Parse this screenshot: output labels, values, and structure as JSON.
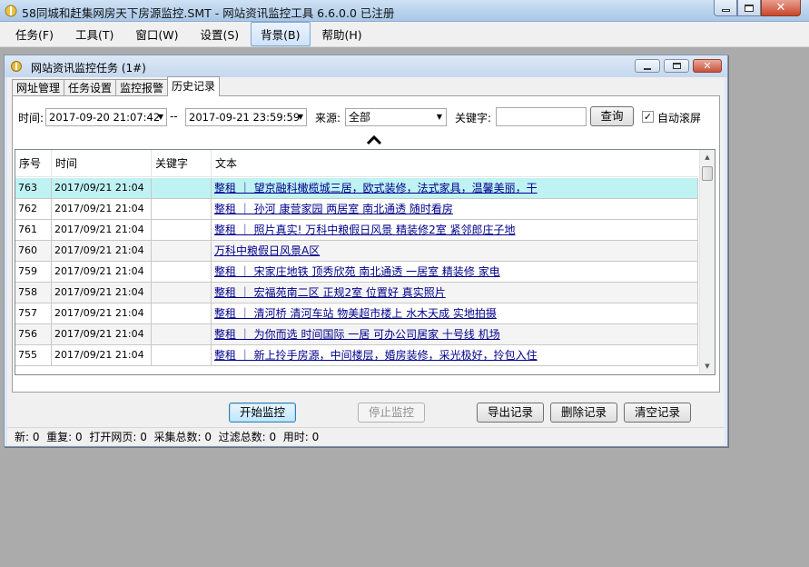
{
  "app": {
    "title": "58同城和赶集网房天下房源监控.SMT  - 网站资讯监控工具 6.6.0.0  已注册"
  },
  "menu": [
    {
      "label": "任务(F)"
    },
    {
      "label": "工具(T)"
    },
    {
      "label": "窗口(W)"
    },
    {
      "label": "设置(S)"
    },
    {
      "label": "背景(B)",
      "active": true
    },
    {
      "label": "帮助(H)"
    }
  ],
  "child_window": {
    "title": "网站资讯监控任务  (1#)"
  },
  "tabs": [
    {
      "label": "网址管理"
    },
    {
      "label": "任务设置"
    },
    {
      "label": "监控报警"
    },
    {
      "label": "历史记录",
      "active": true
    }
  ],
  "filter": {
    "time_label": "时间:",
    "start_time": "2017-09-20  21:07:42",
    "separator": "--",
    "end_time": "2017-09-21  23:59:59",
    "source_label": "来源:",
    "source_value": "全部",
    "keyword_label": "关键字:",
    "keyword_value": "",
    "query_button": "查询",
    "auto_scroll_label": "自动滚屏",
    "auto_scroll_checked": true
  },
  "table": {
    "columns": [
      "序号",
      "时间",
      "关键字",
      "文本"
    ],
    "rows": [
      {
        "id": "763",
        "time": "2017/09/21  21:04",
        "keyword": "",
        "text": "整租 ｜ 望京融科橄榄城三居，欧式装修，法式家具，温馨美丽，干"
      },
      {
        "id": "762",
        "time": "2017/09/21  21:04",
        "keyword": "",
        "text": "整租 ｜ 孙河 康营家园 两居室 南北通透 随时看房"
      },
      {
        "id": "761",
        "time": "2017/09/21  21:04",
        "keyword": "",
        "text": "整租 ｜ 照片真实! 万科中粮假日风景 精装修2室 紧邻郎庄子地"
      },
      {
        "id": "760",
        "time": "2017/09/21  21:04",
        "keyword": "",
        "text": "万科中粮假日风景A区"
      },
      {
        "id": "759",
        "time": "2017/09/21  21:04",
        "keyword": "",
        "text": "整租 ｜ 宋家庄地铁 顶秀欣苑 南北通透 一居室 精装修 家电"
      },
      {
        "id": "758",
        "time": "2017/09/21  21:04",
        "keyword": "",
        "text": "整租 ｜ 宏福苑南二区 正规2室 位置好 真实照片"
      },
      {
        "id": "757",
        "time": "2017/09/21  21:04",
        "keyword": "",
        "text": "整租 ｜ 清河桥 清河车站 物美超市楼上 水木天成 实地拍摄"
      },
      {
        "id": "756",
        "time": "2017/09/21  21:04",
        "keyword": "",
        "text": "整租 ｜ 为你而选 时间国际 一居 可办公司居家 十号线 机场"
      },
      {
        "id": "755",
        "time": "2017/09/21  21:04",
        "keyword": "",
        "text": "整租 ｜ 新上拎手房源，中间楼层，婚房装修，采光极好，拎包入住"
      }
    ]
  },
  "buttons": {
    "start": "开始监控",
    "stop": "停止监控",
    "export": "导出记录",
    "delete": "删除记录",
    "clear": "清空记录"
  },
  "status": {
    "new_label": "新:",
    "new": "0",
    "dup_label": "重复:",
    "dup": "0",
    "pages_label": "打开网页:",
    "pages": "0",
    "collect_label": "采集总数:",
    "collect": "0",
    "filter_label": "过滤总数:",
    "filter": "0",
    "time_label": "用时:",
    "time": "0"
  }
}
